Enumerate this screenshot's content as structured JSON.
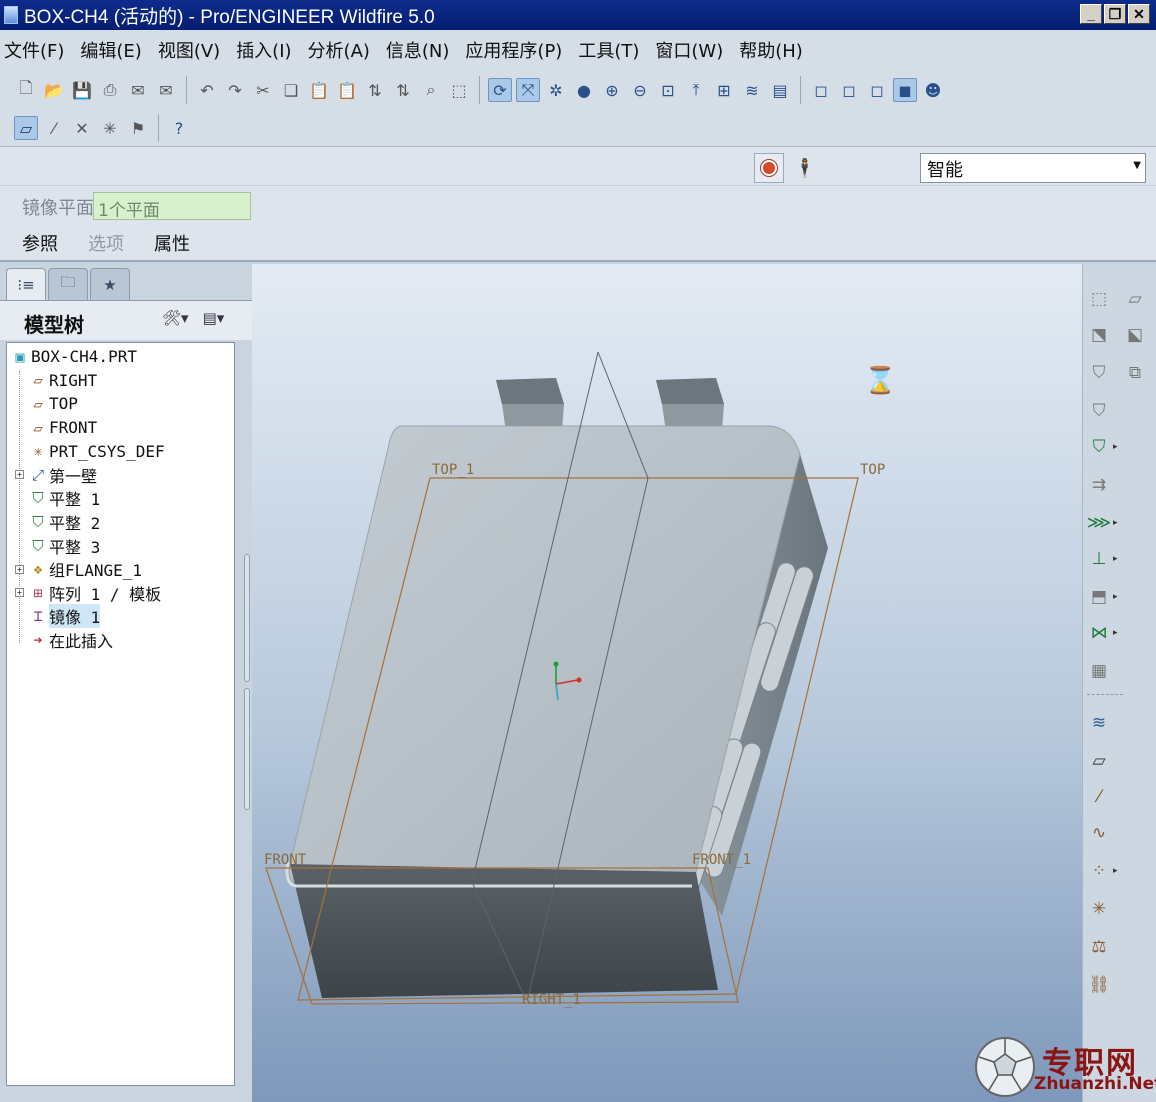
{
  "window": {
    "title": "BOX-CH4 (活动的) - Pro/ENGINEER Wildfire 5.0",
    "buttons": [
      "_",
      "❐",
      "✕"
    ]
  },
  "menu": [
    "文件(F)",
    "编辑(E)",
    "视图(V)",
    "插入(I)",
    "分析(A)",
    "信息(N)",
    "应用程序(P)",
    "工具(T)",
    "窗口(W)",
    "帮助(H)"
  ],
  "dashboard": {
    "filter_value": "智能",
    "field_label": "镜像平面",
    "field_value": "1个平面",
    "tabs": [
      "参照",
      "选项",
      "属性"
    ]
  },
  "model_tree": {
    "title": "模型树",
    "items": [
      {
        "label": "BOX-CH4.PRT",
        "icon": "part-icon"
      },
      {
        "label": "RIGHT",
        "icon": "datum-plane-icon"
      },
      {
        "label": "TOP",
        "icon": "datum-plane-icon"
      },
      {
        "label": "FRONT",
        "icon": "datum-plane-icon"
      },
      {
        "label": "PRT_CSYS_DEF",
        "icon": "csys-icon"
      },
      {
        "label": "第一壁",
        "icon": "wall-icon"
      },
      {
        "label": "平整 1",
        "icon": "flat-wall-icon"
      },
      {
        "label": "平整 2",
        "icon": "flat-wall-icon"
      },
      {
        "label": "平整 3",
        "icon": "flat-wall-icon"
      },
      {
        "label": "组FLANGE_1",
        "icon": "group-icon"
      },
      {
        "label": "阵列 1 / 模板",
        "icon": "pattern-icon"
      },
      {
        "label": "镜像 1",
        "icon": "mirror-icon"
      },
      {
        "label": "在此插入",
        "icon": "insert-here-icon"
      }
    ]
  },
  "viewport": {
    "datum_labels": [
      "TOP_1",
      "TOP",
      "FRONT",
      "FRONT_1",
      "RIGHT_1"
    ]
  },
  "watermark": {
    "cn": "专职网",
    "en": "Zhuanzhi.Net"
  }
}
